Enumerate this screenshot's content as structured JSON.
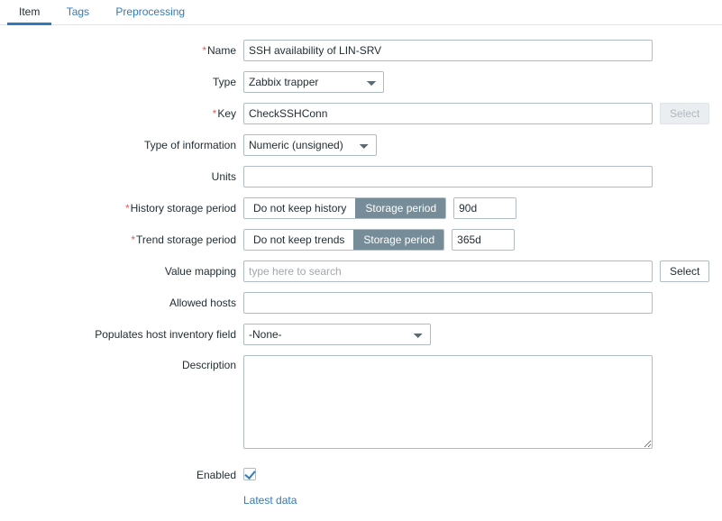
{
  "tabs": [
    {
      "label": "Item",
      "active": true
    },
    {
      "label": "Tags",
      "active": false
    },
    {
      "label": "Preprocessing",
      "active": false
    }
  ],
  "form": {
    "name": {
      "label": "Name",
      "required": true,
      "value": "SSH availability of LIN-SRV",
      "placeholder": ""
    },
    "type": {
      "label": "Type",
      "required": false,
      "value": "Zabbix trapper",
      "options": [
        "Zabbix trapper"
      ]
    },
    "key": {
      "label": "Key",
      "required": true,
      "value": "CheckSSHConn",
      "placeholder": "",
      "select_button": "Select",
      "select_disabled": true
    },
    "type_of_information": {
      "label": "Type of information",
      "required": false,
      "value": "Numeric (unsigned)",
      "options": [
        "Numeric (unsigned)"
      ]
    },
    "units": {
      "label": "Units",
      "required": false,
      "value": "",
      "placeholder": ""
    },
    "history_storage_period": {
      "label": "History storage period",
      "required": true,
      "options": [
        "Do not keep history",
        "Storage period"
      ],
      "selected": "Storage period",
      "value": "90d"
    },
    "trend_storage_period": {
      "label": "Trend storage period",
      "required": true,
      "options": [
        "Do not keep trends",
        "Storage period"
      ],
      "selected": "Storage period",
      "value": "365d"
    },
    "value_mapping": {
      "label": "Value mapping",
      "required": false,
      "value": "",
      "placeholder": "type here to search",
      "select_button": "Select",
      "select_disabled": false
    },
    "allowed_hosts": {
      "label": "Allowed hosts",
      "required": false,
      "value": "",
      "placeholder": ""
    },
    "populates_host_inventory_field": {
      "label": "Populates host inventory field",
      "required": false,
      "value": "-None-",
      "options": [
        "-None-"
      ]
    },
    "description": {
      "label": "Description",
      "required": false,
      "value": "",
      "placeholder": ""
    },
    "enabled": {
      "label": "Enabled",
      "checked": true
    },
    "latest_data_link": {
      "label": "Latest data"
    }
  },
  "colors": {
    "accent": "#2f7bbd",
    "required_asterisk": "#e45959",
    "segment_selected_bg": "#768d99",
    "input_border": "#b0bcc4",
    "text": "#1f2c33",
    "placeholder": "#9fa8ad",
    "disabled_bg": "#ebeef0"
  }
}
